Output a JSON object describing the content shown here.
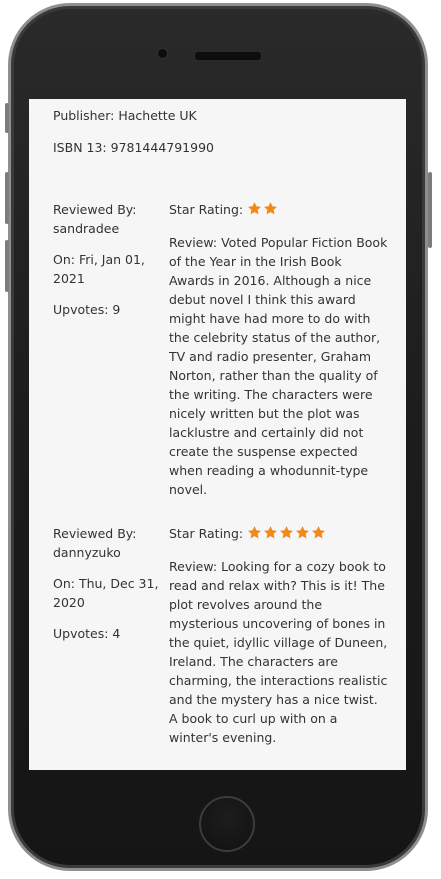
{
  "book": {
    "publisher": "Publisher: Hachette UK",
    "isbn": "ISBN 13: 9781444791990"
  },
  "reviews": [
    {
      "reviewed_by_label": "Reviewed By:",
      "reviewer": "sandradee",
      "date": "On: Fri, Jan 01, 2021",
      "upvotes": "Upvotes: 9",
      "rating_label": "Star Rating:",
      "rating": 2,
      "text": "Review: Voted Popular Fiction Book of the Year in the Irish Book Awards in 2016. Although a nice debut novel I think this award might have had more to do with the celebrity status of the author, TV and radio presenter, Graham Norton, rather than the quality of the writing. The characters were nicely written but the plot was lacklustre and certainly did not create the suspense expected when reading a whodunnit-type novel."
    },
    {
      "reviewed_by_label": "Reviewed By:",
      "reviewer": "dannyzuko",
      "date": "On: Thu, Dec 31, 2020",
      "upvotes": "Upvotes: 4",
      "rating_label": "Star Rating:",
      "rating": 5,
      "text": "Review: Looking for a cozy book to read and relax with? This is it! The plot revolves around the mysterious uncovering of bones in the quiet, idyllic village of Duneen, Ireland. The characters are charming, the interactions realistic and the mystery has a nice twist. A book to curl up with on a winter's evening."
    }
  ],
  "colors": {
    "star": "#f0891c",
    "text": "#333333",
    "screen_bg": "#f6f6f6"
  }
}
